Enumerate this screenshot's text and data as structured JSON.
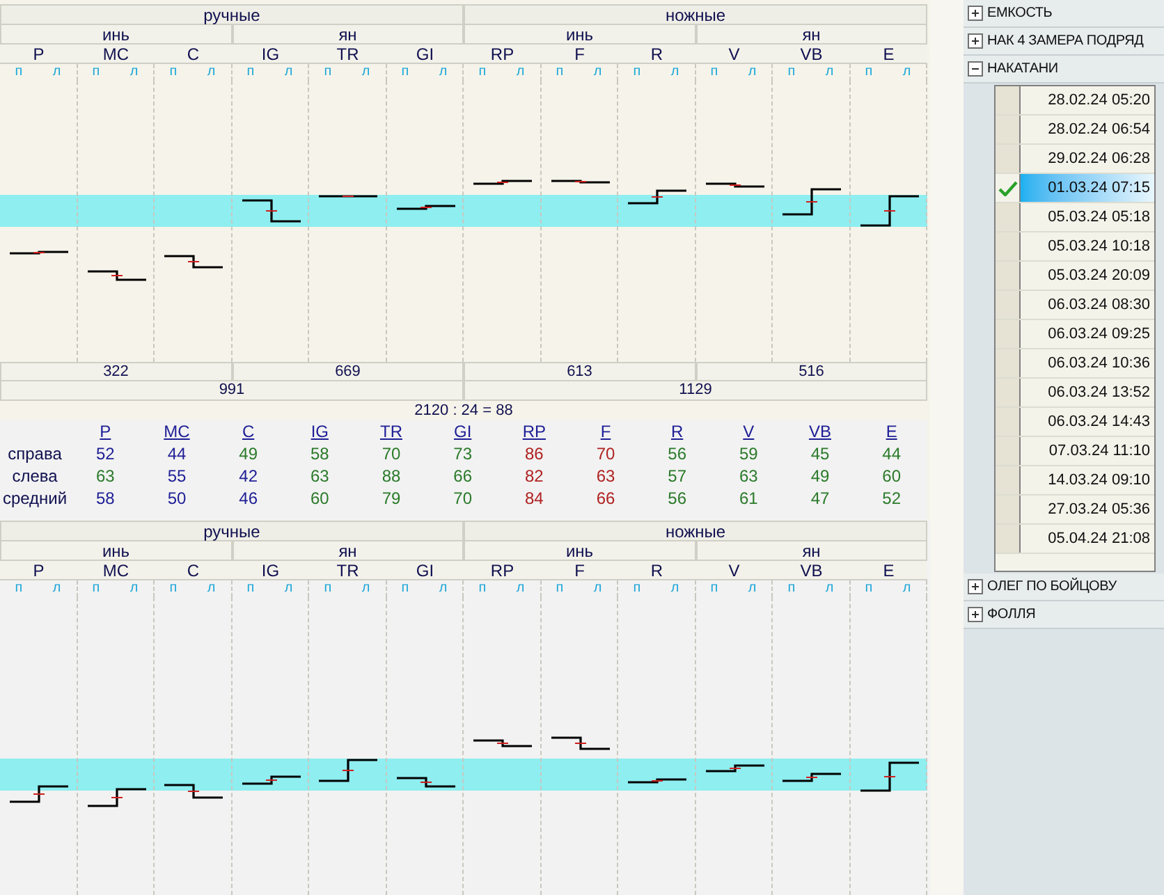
{
  "top_panel": {
    "groups": [
      {
        "label": "ручные",
        "subgroups": [
          {
            "label": "инь",
            "channels": [
              {
                "name": "P",
                "sides": [
                  "п",
                  "л"
                ]
              },
              {
                "name": "MC",
                "sides": [
                  "п",
                  "л"
                ]
              },
              {
                "name": "C",
                "sides": [
                  "п",
                  "л"
                ]
              }
            ]
          },
          {
            "label": "ян",
            "channels": [
              {
                "name": "IG",
                "sides": [
                  "п",
                  "л"
                ]
              },
              {
                "name": "TR",
                "sides": [
                  "п",
                  "л"
                ]
              },
              {
                "name": "GI",
                "sides": [
                  "п",
                  "л"
                ]
              }
            ]
          }
        ]
      },
      {
        "label": "ножные",
        "subgroups": [
          {
            "label": "инь",
            "channels": [
              {
                "name": "RP",
                "sides": [
                  "п",
                  "л"
                ]
              },
              {
                "name": "F",
                "sides": [
                  "п",
                  "л"
                ]
              },
              {
                "name": "R",
                "sides": [
                  "п",
                  "л"
                ]
              }
            ]
          },
          {
            "label": "ян",
            "channels": [
              {
                "name": "V",
                "sides": [
                  "п",
                  "л"
                ]
              },
              {
                "name": "VB",
                "sides": [
                  "п",
                  "л"
                ]
              },
              {
                "name": "E",
                "sides": [
                  "п",
                  "л"
                ]
              }
            ]
          }
        ]
      }
    ],
    "subgroup_sums": [
      "322",
      "669",
      "613",
      "516"
    ],
    "group_sums": [
      "991",
      "1129"
    ],
    "total": "2120 : 24 = 88"
  },
  "table": {
    "columns": [
      "P",
      "MC",
      "C",
      "IG",
      "TR",
      "GI",
      "RP",
      "F",
      "R",
      "V",
      "VB",
      "E"
    ],
    "rows": [
      {
        "label": "справа",
        "values": [
          {
            "text": "52",
            "color": "#1e1e96"
          },
          {
            "text": "44",
            "color": "#1e1e96"
          },
          {
            "text": "49",
            "color": "#2a7a2a"
          },
          {
            "text": "58",
            "color": "#2a7a2a"
          },
          {
            "text": "70",
            "color": "#2a7a2a"
          },
          {
            "text": "73",
            "color": "#2a7a2a"
          },
          {
            "text": "86",
            "color": "#b02222"
          },
          {
            "text": "70",
            "color": "#b02222"
          },
          {
            "text": "56",
            "color": "#2a7a2a"
          },
          {
            "text": "59",
            "color": "#2a7a2a"
          },
          {
            "text": "45",
            "color": "#2a7a2a"
          },
          {
            "text": "44",
            "color": "#2a7a2a"
          }
        ]
      },
      {
        "label": "слева",
        "values": [
          {
            "text": "63",
            "color": "#2a7a2a"
          },
          {
            "text": "55",
            "color": "#1e1e96"
          },
          {
            "text": "42",
            "color": "#1e1e96"
          },
          {
            "text": "63",
            "color": "#2a7a2a"
          },
          {
            "text": "88",
            "color": "#2a7a2a"
          },
          {
            "text": "66",
            "color": "#2a7a2a"
          },
          {
            "text": "82",
            "color": "#b02222"
          },
          {
            "text": "63",
            "color": "#b02222"
          },
          {
            "text": "57",
            "color": "#2a7a2a"
          },
          {
            "text": "63",
            "color": "#2a7a2a"
          },
          {
            "text": "49",
            "color": "#2a7a2a"
          },
          {
            "text": "60",
            "color": "#2a7a2a"
          }
        ]
      },
      {
        "label": "средний",
        "values": [
          {
            "text": "58",
            "color": "#1e1e96"
          },
          {
            "text": "50",
            "color": "#1e1e96"
          },
          {
            "text": "46",
            "color": "#1e1e96"
          },
          {
            "text": "60",
            "color": "#2a7a2a"
          },
          {
            "text": "79",
            "color": "#2a7a2a"
          },
          {
            "text": "70",
            "color": "#2a7a2a"
          },
          {
            "text": "84",
            "color": "#b02222"
          },
          {
            "text": "66",
            "color": "#b02222"
          },
          {
            "text": "56",
            "color": "#2a7a2a"
          },
          {
            "text": "61",
            "color": "#2a7a2a"
          },
          {
            "text": "47",
            "color": "#2a7a2a"
          },
          {
            "text": "52",
            "color": "#2a7a2a"
          }
        ]
      }
    ]
  },
  "bottom_panel": {
    "groups": [
      {
        "label": "ручные",
        "subgroups": [
          {
            "label": "инь",
            "channels": [
              {
                "name": "P",
                "sides": [
                  "п",
                  "л"
                ]
              },
              {
                "name": "MC",
                "sides": [
                  "п",
                  "л"
                ]
              },
              {
                "name": "C",
                "sides": [
                  "п",
                  "л"
                ]
              }
            ]
          },
          {
            "label": "ян",
            "channels": [
              {
                "name": "IG",
                "sides": [
                  "п",
                  "л"
                ]
              },
              {
                "name": "TR",
                "sides": [
                  "п",
                  "л"
                ]
              },
              {
                "name": "GI",
                "sides": [
                  "п",
                  "л"
                ]
              }
            ]
          }
        ]
      },
      {
        "label": "ножные",
        "subgroups": [
          {
            "label": "инь",
            "channels": [
              {
                "name": "RP",
                "sides": [
                  "п",
                  "л"
                ]
              },
              {
                "name": "F",
                "sides": [
                  "п",
                  "л"
                ]
              },
              {
                "name": "R",
                "sides": [
                  "п",
                  "л"
                ]
              }
            ]
          },
          {
            "label": "ян",
            "channels": [
              {
                "name": "V",
                "sides": [
                  "п",
                  "л"
                ]
              },
              {
                "name": "VB",
                "sides": [
                  "п",
                  "л"
                ]
              },
              {
                "name": "E",
                "sides": [
                  "п",
                  "л"
                ]
              }
            ]
          }
        ]
      }
    ]
  },
  "sidebar": {
    "sections": [
      {
        "label": "ЕМКОСТЬ",
        "expanded": false
      },
      {
        "label": "НАК 4 ЗАМЕРА ПОДРЯД",
        "expanded": false
      },
      {
        "label": "НАКАТАНИ",
        "expanded": true,
        "records": [
          {
            "date": "28.02.24 05:20",
            "checked": false,
            "selected": false
          },
          {
            "date": "28.02.24 06:54",
            "checked": false,
            "selected": false
          },
          {
            "date": "29.02.24 06:28",
            "checked": false,
            "selected": false
          },
          {
            "date": "01.03.24 07:15",
            "checked": true,
            "selected": true
          },
          {
            "date": "05.03.24 05:18",
            "checked": false,
            "selected": false
          },
          {
            "date": "05.03.24 10:18",
            "checked": false,
            "selected": false
          },
          {
            "date": "05.03.24 20:09",
            "checked": false,
            "selected": false
          },
          {
            "date": "06.03.24 08:30",
            "checked": false,
            "selected": false
          },
          {
            "date": "06.03.24 09:25",
            "checked": false,
            "selected": false
          },
          {
            "date": "06.03.24 10:36",
            "checked": false,
            "selected": false
          },
          {
            "date": "06.03.24 13:52",
            "checked": false,
            "selected": false
          },
          {
            "date": "06.03.24 14:43",
            "checked": false,
            "selected": false
          },
          {
            "date": "07.03.24 11:10",
            "checked": false,
            "selected": false
          },
          {
            "date": "14.03.24 09:10",
            "checked": false,
            "selected": false
          },
          {
            "date": "27.03.24 05:36",
            "checked": false,
            "selected": false
          },
          {
            "date": "05.04.24 21:08",
            "checked": false,
            "selected": false
          }
        ]
      },
      {
        "label": "ОЛЕГ ПО БОЙЦОВУ",
        "expanded": false
      },
      {
        "label": "ФОЛЛЯ",
        "expanded": false
      }
    ]
  }
}
